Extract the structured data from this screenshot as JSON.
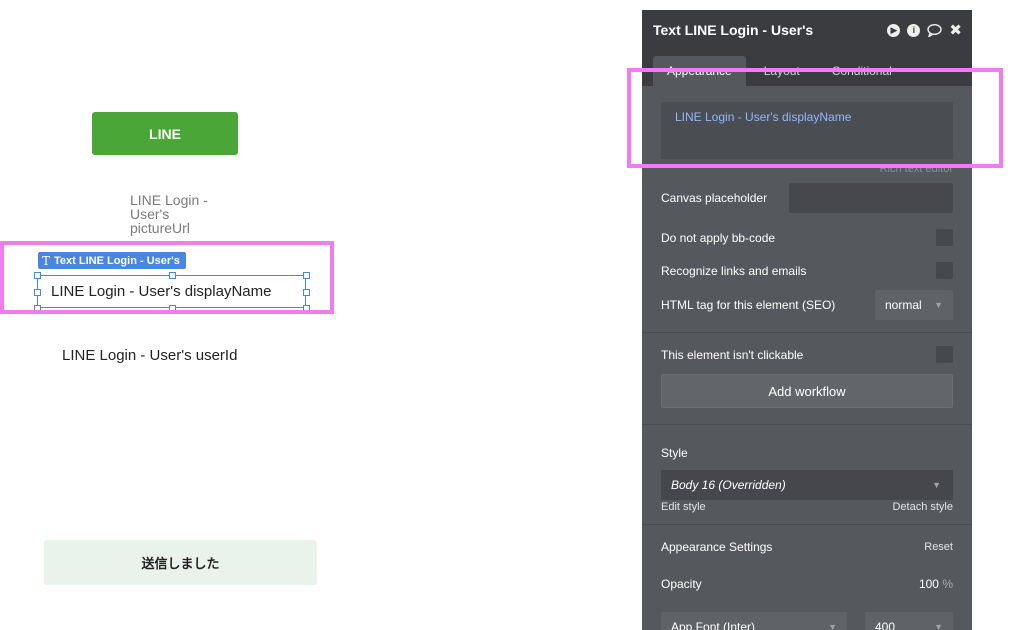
{
  "canvas": {
    "line_button_label": "LINE",
    "picture_url_text": "LINE Login - User's pictureUrl",
    "selected_badge_label": "Text LINE Login - User's",
    "selected_badge_icon": "T",
    "display_name_text": "LINE Login - User's displayName",
    "user_id_text": "LINE Login - User's userId",
    "sent_message": "送信しました"
  },
  "panel": {
    "title": "Text LINE Login - User's",
    "tabs": [
      "Appearance",
      "Layout",
      "Conditional"
    ],
    "content_value": "LINE Login - User's displayName",
    "rich_text_editor_link": "Rich text editor",
    "canvas_placeholder_label": "Canvas placeholder",
    "canvas_placeholder_value": "",
    "no_bbcode_label": "Do not apply bb-code",
    "recognize_links_label": "Recognize links and emails",
    "html_tag_label": "HTML tag for this element (SEO)",
    "html_tag_value": "normal",
    "not_clickable_label": "This element isn't clickable",
    "add_workflow_label": "Add workflow",
    "style_label": "Style",
    "style_value": "Body 16 (Overridden)",
    "edit_style_label": "Edit style",
    "detach_style_label": "Detach style",
    "appearance_settings_label": "Appearance Settings",
    "reset_label": "Reset",
    "opacity_label": "Opacity",
    "opacity_value": "100",
    "opacity_unit": "%",
    "font_value": "App Font (Inter)",
    "font_weight_value": "400"
  },
  "colors": {
    "line_green": "#4aa637",
    "selection_blue": "#4a86e0",
    "highlight_pink": "#f07cf0",
    "panel_bg": "#55585d",
    "panel_header": "#3a3c40"
  }
}
